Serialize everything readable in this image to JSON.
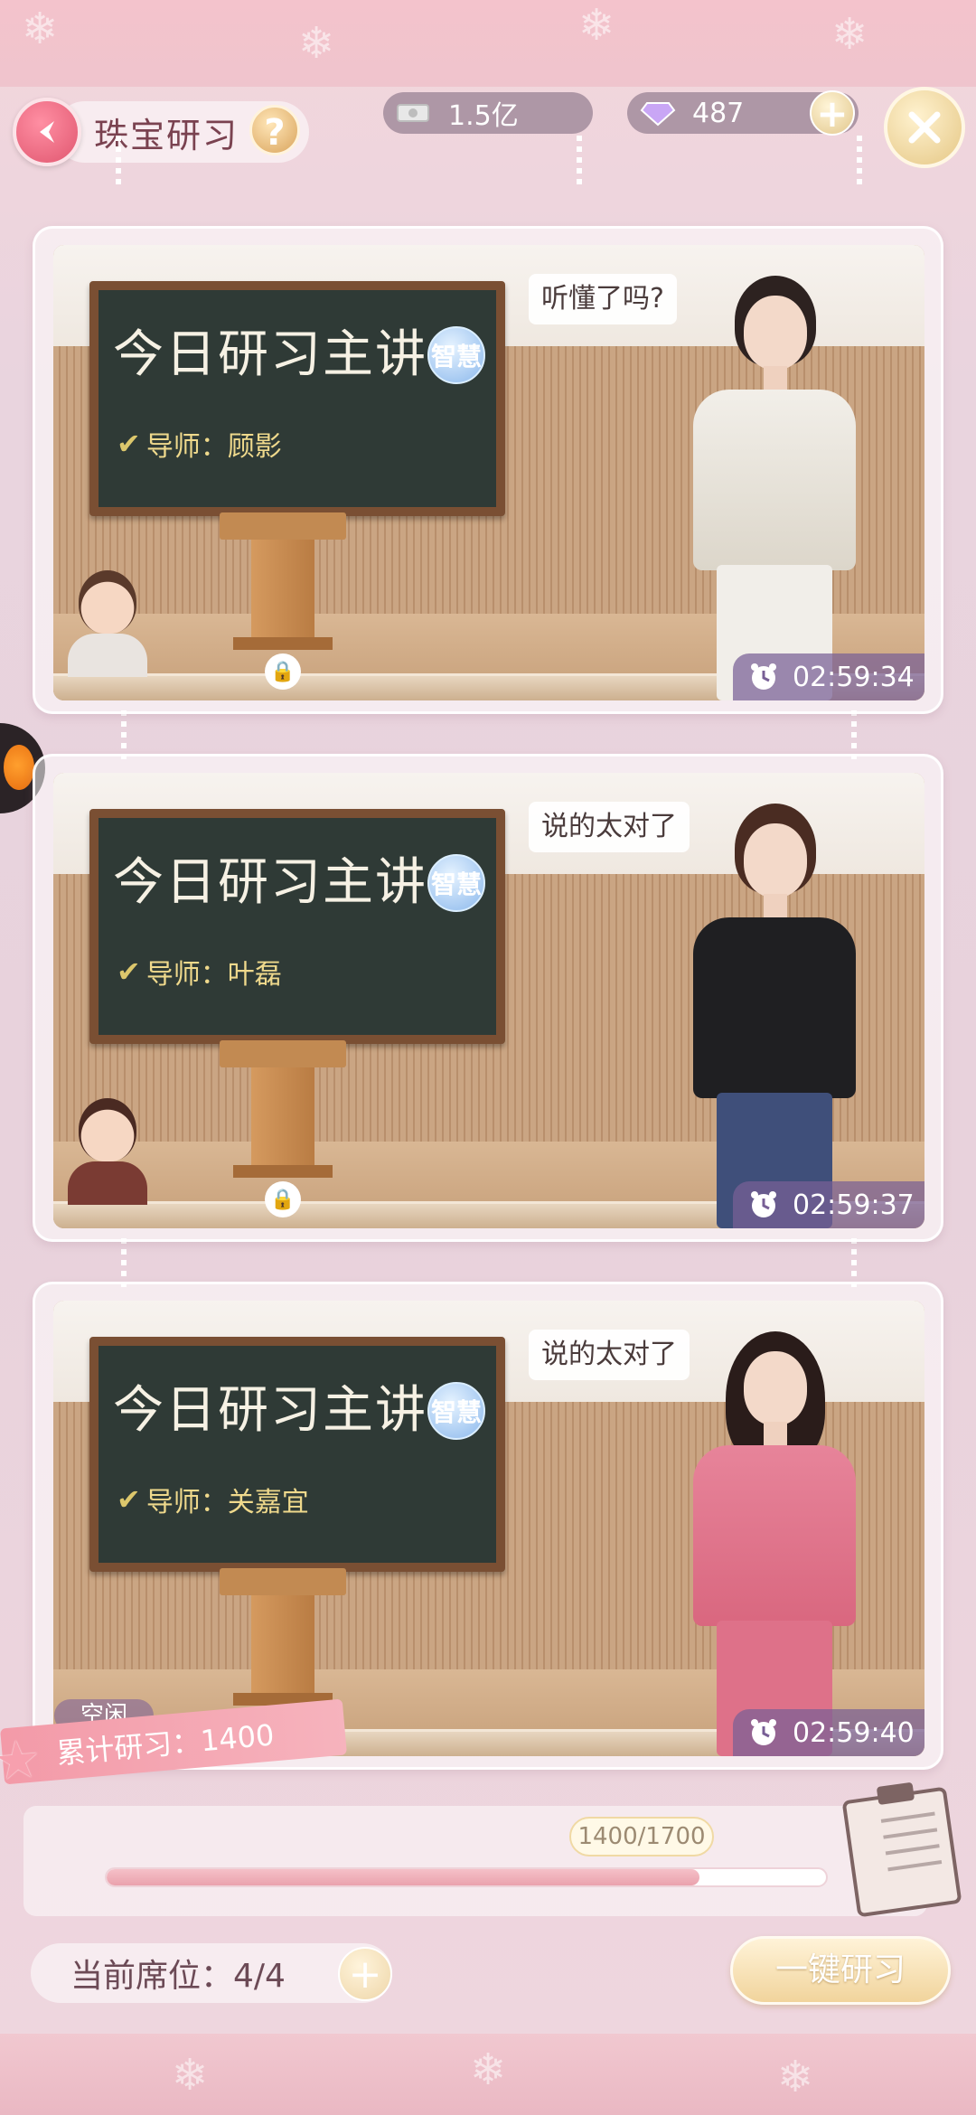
{
  "header": {
    "title": "珠宝研习",
    "help": "?",
    "money": "1.5亿",
    "gems": "487",
    "plus": "+"
  },
  "cards": [
    {
      "board_title": "今日研习主讲",
      "badge": "智慧",
      "teacher": "导师：顾影",
      "speech": "听懂了吗?",
      "timer": "02:59:34"
    },
    {
      "board_title": "今日研习主讲",
      "badge": "智慧",
      "teacher": "导师：叶磊",
      "speech": "说的太对了",
      "timer": "02:59:37"
    },
    {
      "board_title": "今日研习主讲",
      "badge": "智慧",
      "teacher": "导师：关嘉宜",
      "speech": "说的太对了",
      "timer": "02:59:40",
      "status": "空闲"
    }
  ],
  "footer": {
    "total": "累计研习：1400",
    "progress_text": "1400/1700",
    "progress_fraction": 0.8235,
    "seat": "当前席位：4/4",
    "seat_plus": "+",
    "study_button": "一键研习"
  },
  "icons": [
    "back-arrow-icon",
    "help-icon",
    "money-icon",
    "diamond-icon",
    "plus-icon",
    "close-icon",
    "check-icon",
    "lock-icon",
    "clock-icon",
    "clipboard-icon"
  ],
  "colors": {
    "accent_pink": "#e0566f",
    "gold": "#e5c785",
    "timer_bg": "#785f96"
  }
}
